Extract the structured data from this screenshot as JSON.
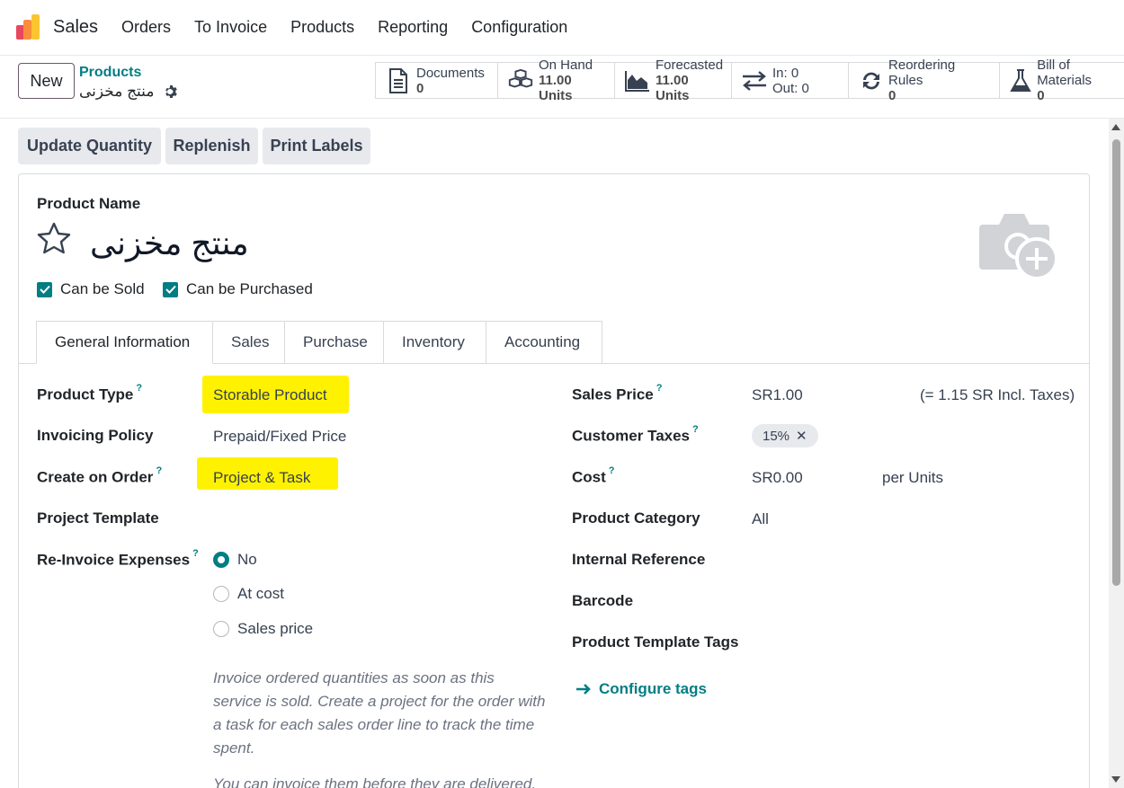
{
  "nav": {
    "app_name": "Sales",
    "menu": [
      "Orders",
      "To Invoice",
      "Products",
      "Reporting",
      "Configuration"
    ]
  },
  "control": {
    "new_label": "New",
    "breadcrumb_parent": "Products",
    "breadcrumb_current": "منتج مخزنى"
  },
  "stats": [
    {
      "icon": "documents-icon",
      "label": "Documents",
      "value": "0"
    },
    {
      "icon": "on-hand-icon",
      "label": "On Hand",
      "value": "11.00 Units"
    },
    {
      "icon": "forecasted-icon",
      "label": "Forecasted",
      "value": "11.00 Units"
    },
    {
      "icon": "in-out-icon",
      "label": "In: 0",
      "value": "Out: 0"
    },
    {
      "icon": "reordering-icon",
      "label": "Reordering Rules",
      "value": "0"
    },
    {
      "icon": "bom-icon",
      "label": "Bill of Materials",
      "value": "0"
    }
  ],
  "actions": [
    "Update Quantity",
    "Replenish",
    "Print Labels"
  ],
  "product": {
    "name_label": "Product Name",
    "name": "منتج مخزنى",
    "can_be_sold": "Can be Sold",
    "can_be_purchased": "Can be Purchased"
  },
  "tabs": [
    "General Information",
    "Sales",
    "Purchase",
    "Inventory",
    "Accounting"
  ],
  "left_fields": {
    "product_type_label": "Product Type",
    "product_type": "Storable Product",
    "invoicing_policy_label": "Invoicing Policy",
    "invoicing_policy": "Prepaid/Fixed Price",
    "create_on_order_label": "Create on Order",
    "create_on_order": "Project & Task",
    "project_template_label": "Project Template",
    "reinvoice_label": "Re-Invoice Expenses",
    "reinvoice_options": [
      "No",
      "At cost",
      "Sales price"
    ],
    "help_text": "Invoice ordered quantities as soon as this service is sold. Create a project for the order with a task for each sales order line to track the time spent.",
    "help_text_2": "You can invoice them before they are delivered."
  },
  "right_fields": {
    "sales_price_label": "Sales Price",
    "sales_price": "SR1.00",
    "sales_price_incl": "(= 1.15 SR Incl. Taxes)",
    "customer_taxes_label": "Customer Taxes",
    "customer_tax_tag": "15%",
    "cost_label": "Cost",
    "cost": "SR0.00",
    "cost_unit": "per Units",
    "product_category_label": "Product Category",
    "product_category": "All",
    "internal_reference_label": "Internal Reference",
    "barcode_label": "Barcode",
    "template_tags_label": "Product Template Tags",
    "configure_tags": "Configure tags"
  },
  "colors": {
    "accent": "#017e84",
    "highlight": "#fff200",
    "brand": "#714b67"
  }
}
